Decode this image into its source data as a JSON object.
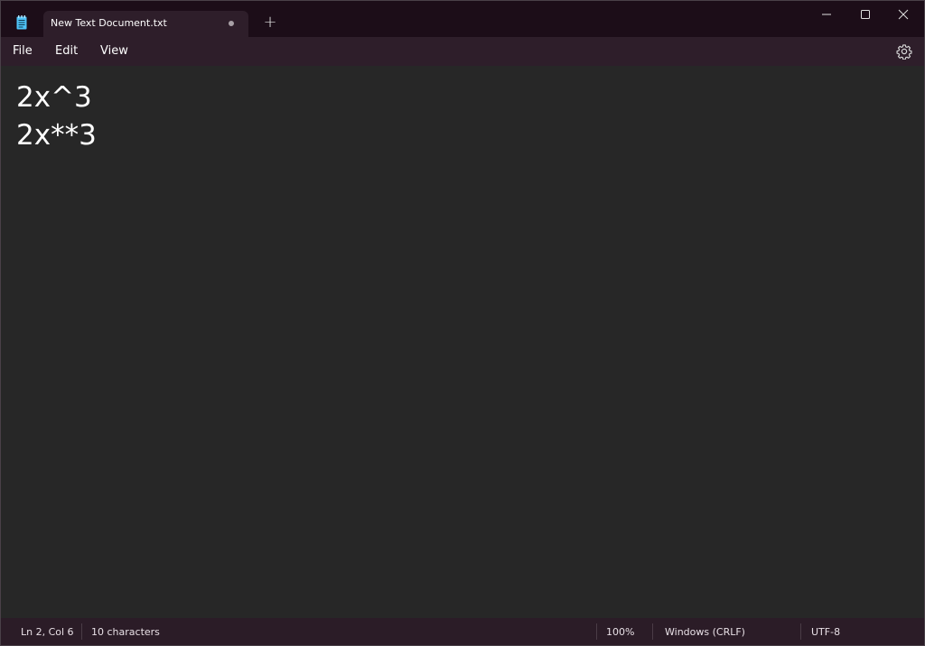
{
  "window": {
    "tab_title": "New Text Document.txt",
    "new_tab_symbol": "+"
  },
  "menu": {
    "file": "File",
    "edit": "Edit",
    "view": "View"
  },
  "editor": {
    "lines": [
      "2x^3",
      "2x**3"
    ]
  },
  "status": {
    "position": "Ln 2, Col 6",
    "characters": "10 characters",
    "zoom": "100%",
    "line_ending": "Windows (CRLF)",
    "encoding": "UTF-8"
  },
  "colors": {
    "titlebar": "#1c0d18",
    "menubar": "#2e1e2a",
    "editor_bg": "#272727",
    "text": "#ffffff",
    "app_icon": "#4fc3f7"
  },
  "icons": {
    "app": "notepad-icon",
    "unsaved": "unsaved-dot-icon",
    "minimize": "minimize-icon",
    "maximize": "maximize-icon",
    "close": "close-icon",
    "settings": "gear-icon"
  }
}
